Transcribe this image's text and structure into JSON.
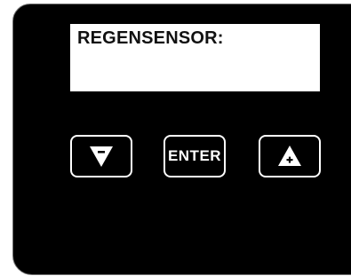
{
  "display": {
    "text": "REGENSENSOR:"
  },
  "buttons": {
    "down": {
      "icon": "down-triangle-minus-icon"
    },
    "enter": {
      "label": "ENTER"
    },
    "up": {
      "icon": "up-triangle-plus-icon"
    }
  },
  "colors": {
    "panel": "#000000",
    "display_bg": "#ffffff",
    "button_border": "#ffffff"
  }
}
